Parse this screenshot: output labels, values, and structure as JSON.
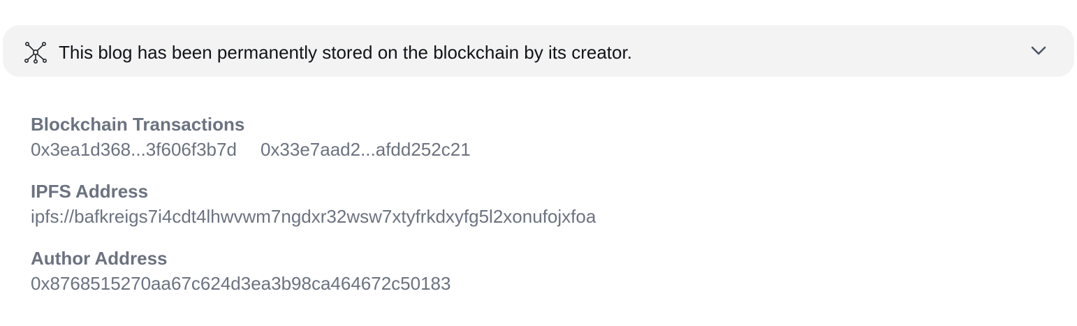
{
  "banner": {
    "icon": "network-nodes-icon",
    "text": "This blog has been permanently stored on the blockchain by its creator.",
    "toggle_icon": "chevron-down-icon"
  },
  "details": {
    "transactions": {
      "label": "Blockchain Transactions",
      "items": [
        "0x3ea1d368...3f606f3b7d",
        "0x33e7aad2...afdd252c21"
      ]
    },
    "ipfs": {
      "label": "IPFS Address",
      "value": "ipfs://bafkreigs7i4cdt4lhwvwm7ngdxr32wsw7xtyfrkdxyfg5l2xonufojxfoa"
    },
    "author": {
      "label": "Author Address",
      "value": "0x8768515270aa67c624d3ea3b98ca464672c50183"
    }
  },
  "colors": {
    "banner_bg": "#f3f3f4",
    "text_dark": "#111318",
    "text_muted": "#6b7280"
  }
}
